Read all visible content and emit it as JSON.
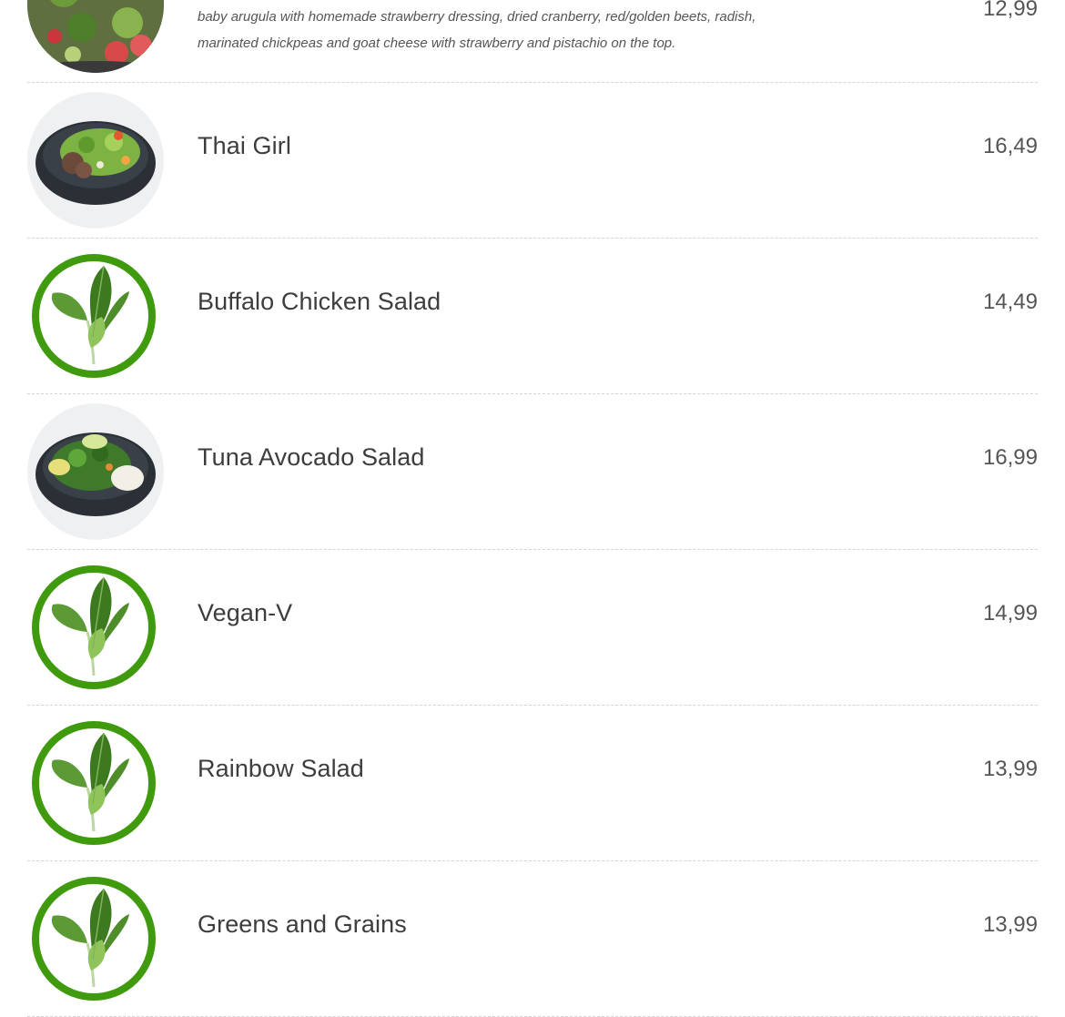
{
  "menu": {
    "items": [
      {
        "name": "",
        "description": "baby arugula with homemade strawberry dressing, dried cranberry, red/golden beets, radish, marinated chickpeas and goat cheese with strawberry and pistachio on the top.",
        "price": "12,99",
        "image": "salad-photo"
      },
      {
        "name": "Thai Girl",
        "price": "16,49",
        "image": "salad-bowl-photo"
      },
      {
        "name": "Buffalo Chicken Salad",
        "price": "14,49",
        "image": "spinach-leaf-icon"
      },
      {
        "name": "Tuna Avocado Salad",
        "price": "16,99",
        "image": "salad-bowl-photo"
      },
      {
        "name": "Vegan-V",
        "price": "14,99",
        "image": "spinach-leaf-icon"
      },
      {
        "name": "Rainbow Salad",
        "price": "13,99",
        "image": "spinach-leaf-icon"
      },
      {
        "name": "Greens and Grains",
        "price": "13,99",
        "image": "spinach-leaf-icon"
      }
    ]
  },
  "colors": {
    "accent_green": "#3f9a0e",
    "divider": "#d4d4d4",
    "bowl": "#2b3036"
  }
}
